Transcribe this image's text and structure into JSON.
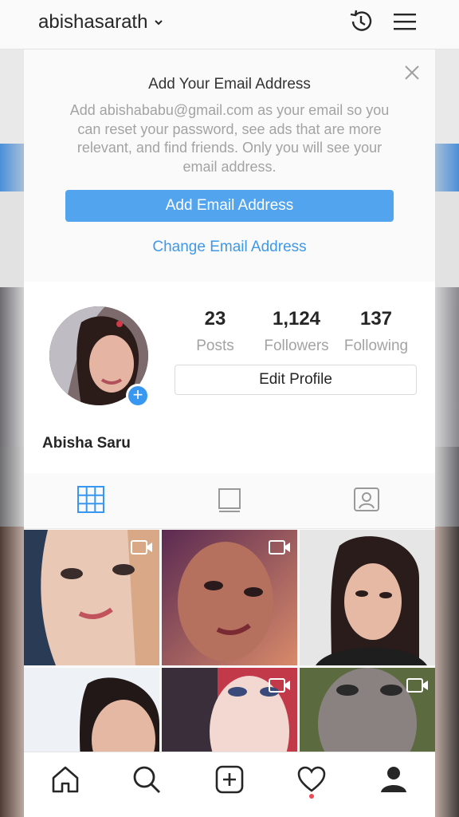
{
  "header": {
    "username": "abishasarath"
  },
  "email_prompt": {
    "title": "Add Your Email Address",
    "description": "Add abishababu@gmail.com as your email so you can reset your password, see ads that are more relevant, and find friends. Only you will see your email address.",
    "primary_button": "Add Email Address",
    "secondary_link": "Change Email Address"
  },
  "profile": {
    "full_name": "Abisha Saru",
    "edit_button": "Edit Profile",
    "stats": [
      {
        "value": "23",
        "label": "Posts"
      },
      {
        "value": "1,124",
        "label": "Followers"
      },
      {
        "value": "137",
        "label": "Following"
      }
    ]
  },
  "tabs": [
    "grid-icon",
    "feed-icon",
    "tagged-icon"
  ],
  "bottom_nav": [
    "home-icon",
    "search-icon",
    "new-post-icon",
    "activity-icon",
    "profile-icon"
  ],
  "colors": {
    "accent_blue": "#3897f0",
    "button_blue": "#53a4ee",
    "notification_red": "#ed4956"
  }
}
